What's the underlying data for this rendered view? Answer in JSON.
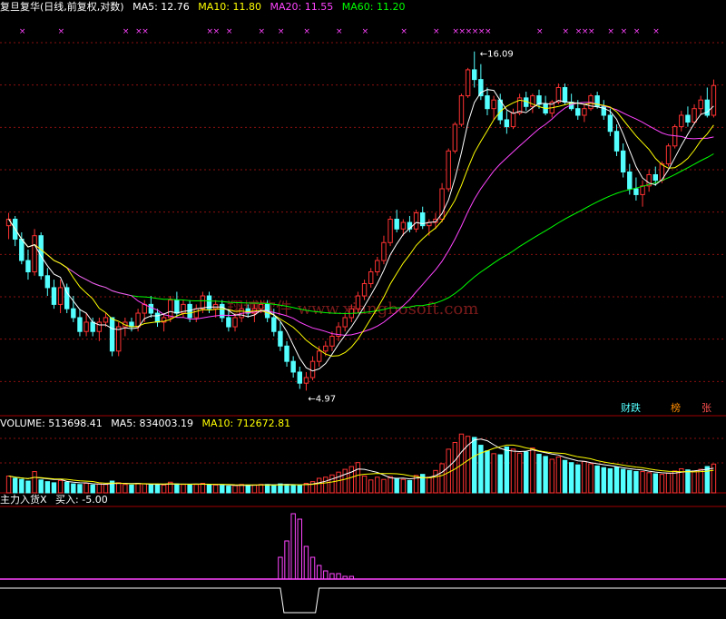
{
  "stock_name": "复旦复华",
  "period_info": "(日线,前复权,对数)",
  "ma_header": [
    {
      "label": "MA5: 12.76",
      "color": "#ffffff"
    },
    {
      "label": "MA10: 11.80",
      "color": "#ffff00"
    },
    {
      "label": "MA20: 11.55",
      "color": "#ff44ff"
    },
    {
      "label": "MA60: 11.20",
      "color": "#00ff00"
    }
  ],
  "volume_header": [
    {
      "label": "VOLUME: 513698.41",
      "color": "#ffffff"
    },
    {
      "label": "MA5: 834003.19",
      "color": "#ffffff"
    },
    {
      "label": "MA10: 712672.81",
      "color": "#ffff00"
    }
  ],
  "indicator_header": [
    {
      "label": "主力入货X",
      "color": "#ffffff"
    },
    {
      "label": "买入: -5.00",
      "color": "#ffffff"
    }
  ],
  "buttons": {
    "caicai": "财跌",
    "bang": "榜",
    "zhang": "张"
  },
  "annotations": {
    "high": "16.09",
    "low": "4.97"
  },
  "watermark": "翔博软件 www.xiangbosoft.com",
  "colors": {
    "up": "#ff3232",
    "down": "#54ffff",
    "ma5": "#ffffff",
    "ma10": "#ffff00",
    "ma20": "#ff44ff",
    "ma60": "#00ff00",
    "grid": "#8a1010",
    "marker": "#ff44ff"
  },
  "chart_data": [
    {
      "type": "candlestick",
      "title": "复旦复华(日线,前复权,对数)",
      "scale": "log",
      "ylim": [
        4.6,
        17.5
      ],
      "high": 16.09,
      "low": 4.97,
      "candles": [
        [
          8.8,
          9.2,
          8.4,
          9.0
        ],
        [
          9.0,
          9.1,
          8.2,
          8.4
        ],
        [
          8.4,
          8.6,
          7.7,
          7.8
        ],
        [
          7.8,
          8.1,
          7.3,
          7.5
        ],
        [
          7.5,
          8.7,
          7.4,
          8.5
        ],
        [
          8.5,
          8.6,
          7.3,
          7.4
        ],
        [
          7.4,
          7.6,
          6.9,
          7.1
        ],
        [
          7.1,
          7.3,
          6.6,
          6.7
        ],
        [
          6.7,
          7.3,
          6.5,
          7.1
        ],
        [
          7.1,
          7.2,
          6.5,
          6.6
        ],
        [
          6.6,
          6.9,
          6.3,
          6.4
        ],
        [
          6.4,
          6.6,
          6.0,
          6.1
        ],
        [
          6.1,
          6.5,
          6.0,
          6.3
        ],
        [
          6.3,
          6.4,
          6.0,
          6.1
        ],
        [
          6.1,
          6.4,
          5.9,
          6.3
        ],
        [
          6.3,
          6.5,
          6.2,
          6.4
        ],
        [
          6.4,
          6.4,
          5.6,
          5.7
        ],
        [
          5.7,
          6.3,
          5.6,
          6.2
        ],
        [
          6.2,
          6.4,
          6.0,
          6.3
        ],
        [
          6.3,
          6.4,
          6.1,
          6.2
        ],
        [
          6.2,
          6.6,
          6.1,
          6.5
        ],
        [
          6.5,
          6.8,
          6.3,
          6.7
        ],
        [
          6.7,
          6.9,
          6.4,
          6.5
        ],
        [
          6.5,
          6.6,
          6.2,
          6.3
        ],
        [
          6.3,
          6.5,
          6.1,
          6.4
        ],
        [
          6.4,
          6.9,
          6.3,
          6.8
        ],
        [
          6.8,
          7.0,
          6.4,
          6.5
        ],
        [
          6.5,
          6.8,
          6.4,
          6.7
        ],
        [
          6.7,
          6.8,
          6.3,
          6.4
        ],
        [
          6.4,
          6.7,
          6.3,
          6.6
        ],
        [
          6.6,
          7.0,
          6.5,
          6.9
        ],
        [
          6.9,
          7.0,
          6.5,
          6.6
        ],
        [
          6.6,
          6.8,
          6.4,
          6.7
        ],
        [
          6.7,
          6.8,
          6.3,
          6.4
        ],
        [
          6.4,
          6.6,
          6.1,
          6.2
        ],
        [
          6.2,
          6.5,
          6.1,
          6.4
        ],
        [
          6.4,
          6.7,
          6.3,
          6.6
        ],
        [
          6.6,
          6.7,
          6.4,
          6.5
        ],
        [
          6.5,
          6.7,
          6.3,
          6.6
        ],
        [
          6.6,
          6.8,
          6.5,
          6.7
        ],
        [
          6.7,
          6.8,
          6.3,
          6.4
        ],
        [
          6.4,
          6.6,
          6.0,
          6.1
        ],
        [
          6.1,
          6.3,
          5.7,
          5.8
        ],
        [
          5.8,
          5.9,
          5.4,
          5.5
        ],
        [
          5.5,
          5.6,
          5.2,
          5.3
        ],
        [
          5.3,
          5.4,
          5.0,
          5.1
        ],
        [
          5.1,
          5.3,
          4.97,
          5.2
        ],
        [
          5.2,
          5.6,
          5.15,
          5.5
        ],
        [
          5.5,
          5.8,
          5.4,
          5.7
        ],
        [
          5.7,
          5.9,
          5.6,
          5.8
        ],
        [
          5.8,
          6.1,
          5.7,
          6.0
        ],
        [
          6.0,
          6.3,
          5.9,
          6.2
        ],
        [
          6.2,
          6.5,
          6.1,
          6.4
        ],
        [
          6.4,
          6.7,
          6.3,
          6.6
        ],
        [
          6.6,
          7.0,
          6.5,
          6.9
        ],
        [
          6.9,
          7.3,
          6.8,
          7.2
        ],
        [
          7.2,
          7.6,
          7.1,
          7.5
        ],
        [
          7.5,
          7.9,
          7.4,
          7.8
        ],
        [
          7.8,
          8.5,
          7.7,
          8.3
        ],
        [
          8.3,
          9.1,
          8.2,
          9.0
        ],
        [
          9.0,
          9.3,
          8.6,
          8.7
        ],
        [
          8.7,
          9.0,
          8.5,
          8.9
        ],
        [
          8.9,
          9.1,
          8.6,
          8.7
        ],
        [
          8.7,
          9.3,
          8.6,
          9.2
        ],
        [
          9.2,
          9.4,
          8.7,
          8.8
        ],
        [
          8.8,
          9.0,
          8.5,
          8.9
        ],
        [
          8.9,
          9.2,
          8.7,
          9.0
        ],
        [
          9.0,
          10.2,
          8.9,
          10.0
        ],
        [
          10.0,
          11.5,
          9.9,
          11.4
        ],
        [
          11.4,
          12.6,
          11.3,
          12.5
        ],
        [
          12.5,
          13.9,
          12.4,
          13.8
        ],
        [
          13.8,
          15.2,
          13.7,
          15.1
        ],
        [
          15.1,
          16.09,
          14.2,
          14.6
        ],
        [
          14.6,
          15.4,
          13.6,
          13.8
        ],
        [
          13.8,
          14.2,
          12.9,
          13.2
        ],
        [
          13.2,
          13.8,
          12.7,
          13.6
        ],
        [
          13.6,
          13.9,
          12.5,
          12.7
        ],
        [
          12.7,
          13.1,
          12.1,
          12.4
        ],
        [
          12.4,
          13.2,
          12.3,
          13.0
        ],
        [
          13.0,
          13.9,
          12.9,
          13.7
        ],
        [
          13.7,
          14.0,
          13.1,
          13.3
        ],
        [
          13.3,
          13.9,
          13.0,
          13.8
        ],
        [
          13.8,
          14.1,
          13.2,
          13.4
        ],
        [
          13.4,
          13.8,
          12.9,
          13.0
        ],
        [
          13.0,
          13.6,
          12.8,
          13.5
        ],
        [
          13.5,
          14.4,
          13.4,
          14.2
        ],
        [
          14.2,
          14.4,
          13.4,
          13.5
        ],
        [
          13.5,
          13.9,
          13.1,
          13.2
        ],
        [
          13.2,
          13.6,
          12.7,
          12.9
        ],
        [
          12.9,
          13.4,
          12.6,
          13.2
        ],
        [
          13.2,
          13.9,
          13.1,
          13.8
        ],
        [
          13.8,
          14.0,
          13.2,
          13.3
        ],
        [
          13.3,
          13.6,
          12.7,
          12.9
        ],
        [
          12.9,
          13.2,
          12.0,
          12.2
        ],
        [
          12.2,
          12.5,
          11.2,
          11.4
        ],
        [
          11.4,
          11.7,
          10.4,
          10.6
        ],
        [
          10.6,
          10.9,
          9.8,
          10.0
        ],
        [
          10.0,
          10.4,
          9.6,
          9.8
        ],
        [
          9.8,
          10.3,
          9.4,
          10.1
        ],
        [
          10.1,
          10.7,
          9.9,
          10.5
        ],
        [
          10.5,
          10.8,
          10.1,
          10.3
        ],
        [
          10.3,
          11.0,
          10.2,
          10.9
        ],
        [
          10.9,
          11.7,
          10.8,
          11.6
        ],
        [
          11.6,
          12.5,
          11.5,
          12.4
        ],
        [
          12.4,
          13.1,
          12.2,
          12.9
        ],
        [
          12.9,
          13.3,
          12.4,
          12.6
        ],
        [
          12.6,
          13.4,
          12.5,
          13.2
        ],
        [
          13.2,
          13.8,
          12.9,
          13.6
        ],
        [
          13.6,
          14.2,
          12.8,
          12.9
        ],
        [
          12.9,
          14.6,
          12.8,
          14.3
        ]
      ],
      "marker_x": [
        2,
        8,
        18,
        20,
        21,
        31,
        32,
        34,
        39,
        42,
        46,
        51,
        55,
        61,
        66,
        69,
        70,
        71,
        72,
        73,
        74,
        82,
        86,
        88,
        89,
        90,
        93,
        95,
        97,
        100
      ],
      "volume": {
        "title": "VOLUME",
        "value": 513698.41,
        "ma5": 834003.19,
        "ma10": 712672.81,
        "values": [
          300,
          260,
          240,
          210,
          380,
          230,
          200,
          180,
          220,
          190,
          160,
          150,
          170,
          140,
          160,
          150,
          210,
          180,
          150,
          140,
          170,
          160,
          150,
          140,
          140,
          190,
          160,
          150,
          140,
          150,
          170,
          150,
          140,
          130,
          120,
          130,
          150,
          140,
          140,
          150,
          150,
          140,
          160,
          150,
          140,
          130,
          170,
          200,
          260,
          280,
          320,
          370,
          420,
          470,
          540,
          300,
          230,
          280,
          240,
          290,
          260,
          240,
          220,
          310,
          330,
          280,
          400,
          520,
          780,
          900,
          1050,
          1010,
          990,
          850,
          750,
          700,
          680,
          820,
          780,
          710,
          730,
          800,
          690,
          650,
          600,
          640,
          580,
          540,
          500,
          560,
          520,
          480,
          450,
          430,
          460,
          420,
          400,
          380,
          380,
          360,
          340,
          330,
          350,
          390,
          430,
          410,
          380,
          420,
          470,
          514
        ]
      },
      "indicator": {
        "name": "主力入货X",
        "buy_value": -5.0,
        "bars": [
          [
            42,
            8
          ],
          [
            43,
            14
          ],
          [
            44,
            24
          ],
          [
            45,
            22
          ],
          [
            46,
            12
          ],
          [
            47,
            8
          ],
          [
            48,
            5
          ],
          [
            49,
            3
          ],
          [
            50,
            2
          ],
          [
            51,
            2
          ],
          [
            52,
            1
          ],
          [
            53,
            1
          ]
        ],
        "signal_range": [
          42,
          48
        ]
      }
    }
  ]
}
